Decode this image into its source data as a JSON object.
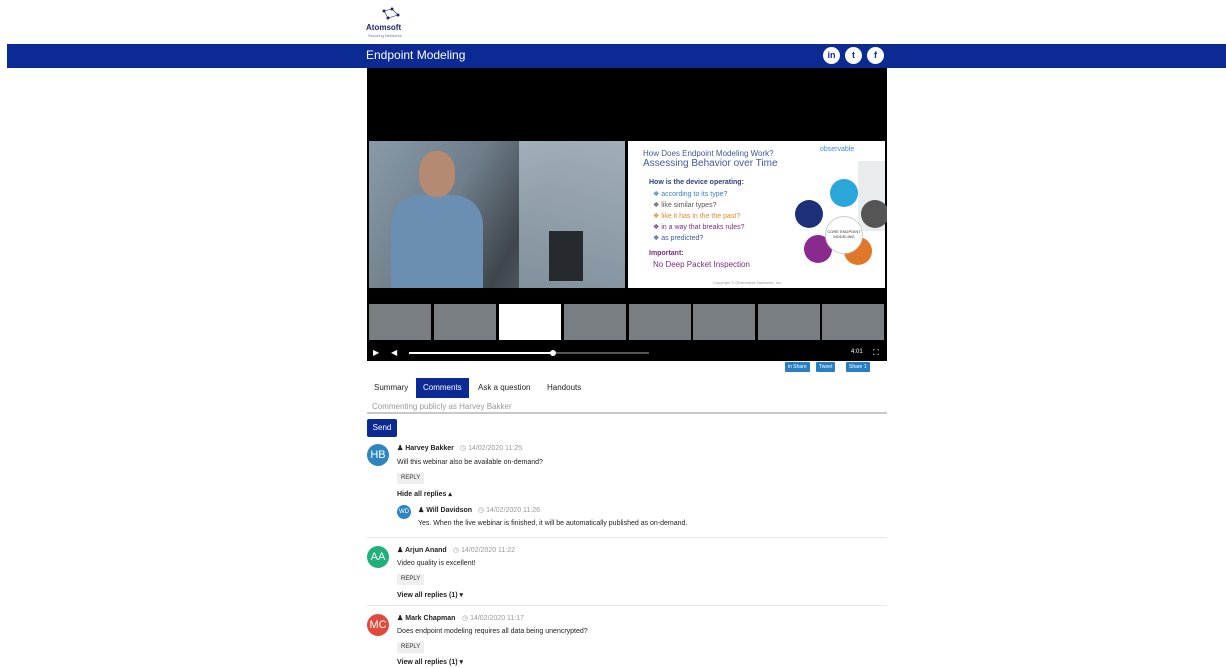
{
  "brand": {
    "name": "Atomsoft",
    "tagline": "Securing Networks"
  },
  "header": {
    "title": "Endpoint Modeling",
    "social": [
      "in",
      "t",
      "f"
    ]
  },
  "slide": {
    "pre_title": "How Does Endpoint Modeling Work?",
    "title": "Assessing Behavior over Time",
    "brand": "observable",
    "question": "How is the device operating:",
    "items": [
      {
        "text": "❖ according to its type?",
        "color": "#3b7fc4"
      },
      {
        "text": "❖ like similar types?",
        "color": "#555555"
      },
      {
        "text": "❖ like it has in the the past?",
        "color": "#e08a2a"
      },
      {
        "text": "❖ in a way that breaks rules?",
        "color": "#7a2a82"
      },
      {
        "text": "❖ as predicted?",
        "color": "#3d5a9e"
      }
    ],
    "important_label": "Important:",
    "important_text": "No Deep Packet Inspection",
    "copyright": "Copyright © Observable Networks, Inc.",
    "hub_text": "CORE ENDPOINT MODELING",
    "node_colors": [
      "#2aa6d8",
      "#1e2f7a",
      "#8a2a8e",
      "#e0782a",
      "#555555"
    ]
  },
  "player": {
    "time": "4:01",
    "progress": 0.6
  },
  "share": [
    "in Share",
    "Tweet",
    "Share 1"
  ],
  "tabs": [
    "Summary",
    "Comments",
    "Ask a question",
    "Handouts"
  ],
  "comment_box": {
    "placeholder": "Commenting publicly as Harvey Bakker"
  },
  "send_label": "Send",
  "comments": [
    {
      "initials": "HB",
      "color": "#2e86c1",
      "author": "Harvey Bakker",
      "time": "14/02/2020 11:25",
      "text": "Will this webinar also be available on-demand?",
      "reply_label": "REPLY",
      "replies_label": "Hide all replies ▴",
      "reply": {
        "initials": "WD",
        "color": "#2e86c1",
        "author": "Will Davidson",
        "time": "14/02/2020 11:26",
        "text": "Yes. When the live webinar is finished, it will be automatically published as on-demand."
      }
    },
    {
      "initials": "AA",
      "color": "#20b07a",
      "author": "Arjun Anand",
      "time": "14/02/2020 11:22",
      "text": "Video quality is excellent!",
      "reply_label": "REPLY",
      "replies_label": "View all replies (1) ▾"
    },
    {
      "initials": "MC",
      "color": "#e04a3c",
      "author": "Mark Chapman",
      "time": "14/02/2020 11:17",
      "text": "Does endpoint modeling requires all data being unencrypted?",
      "reply_label": "REPLY",
      "replies_label": "View all replies (1) ▾"
    }
  ]
}
